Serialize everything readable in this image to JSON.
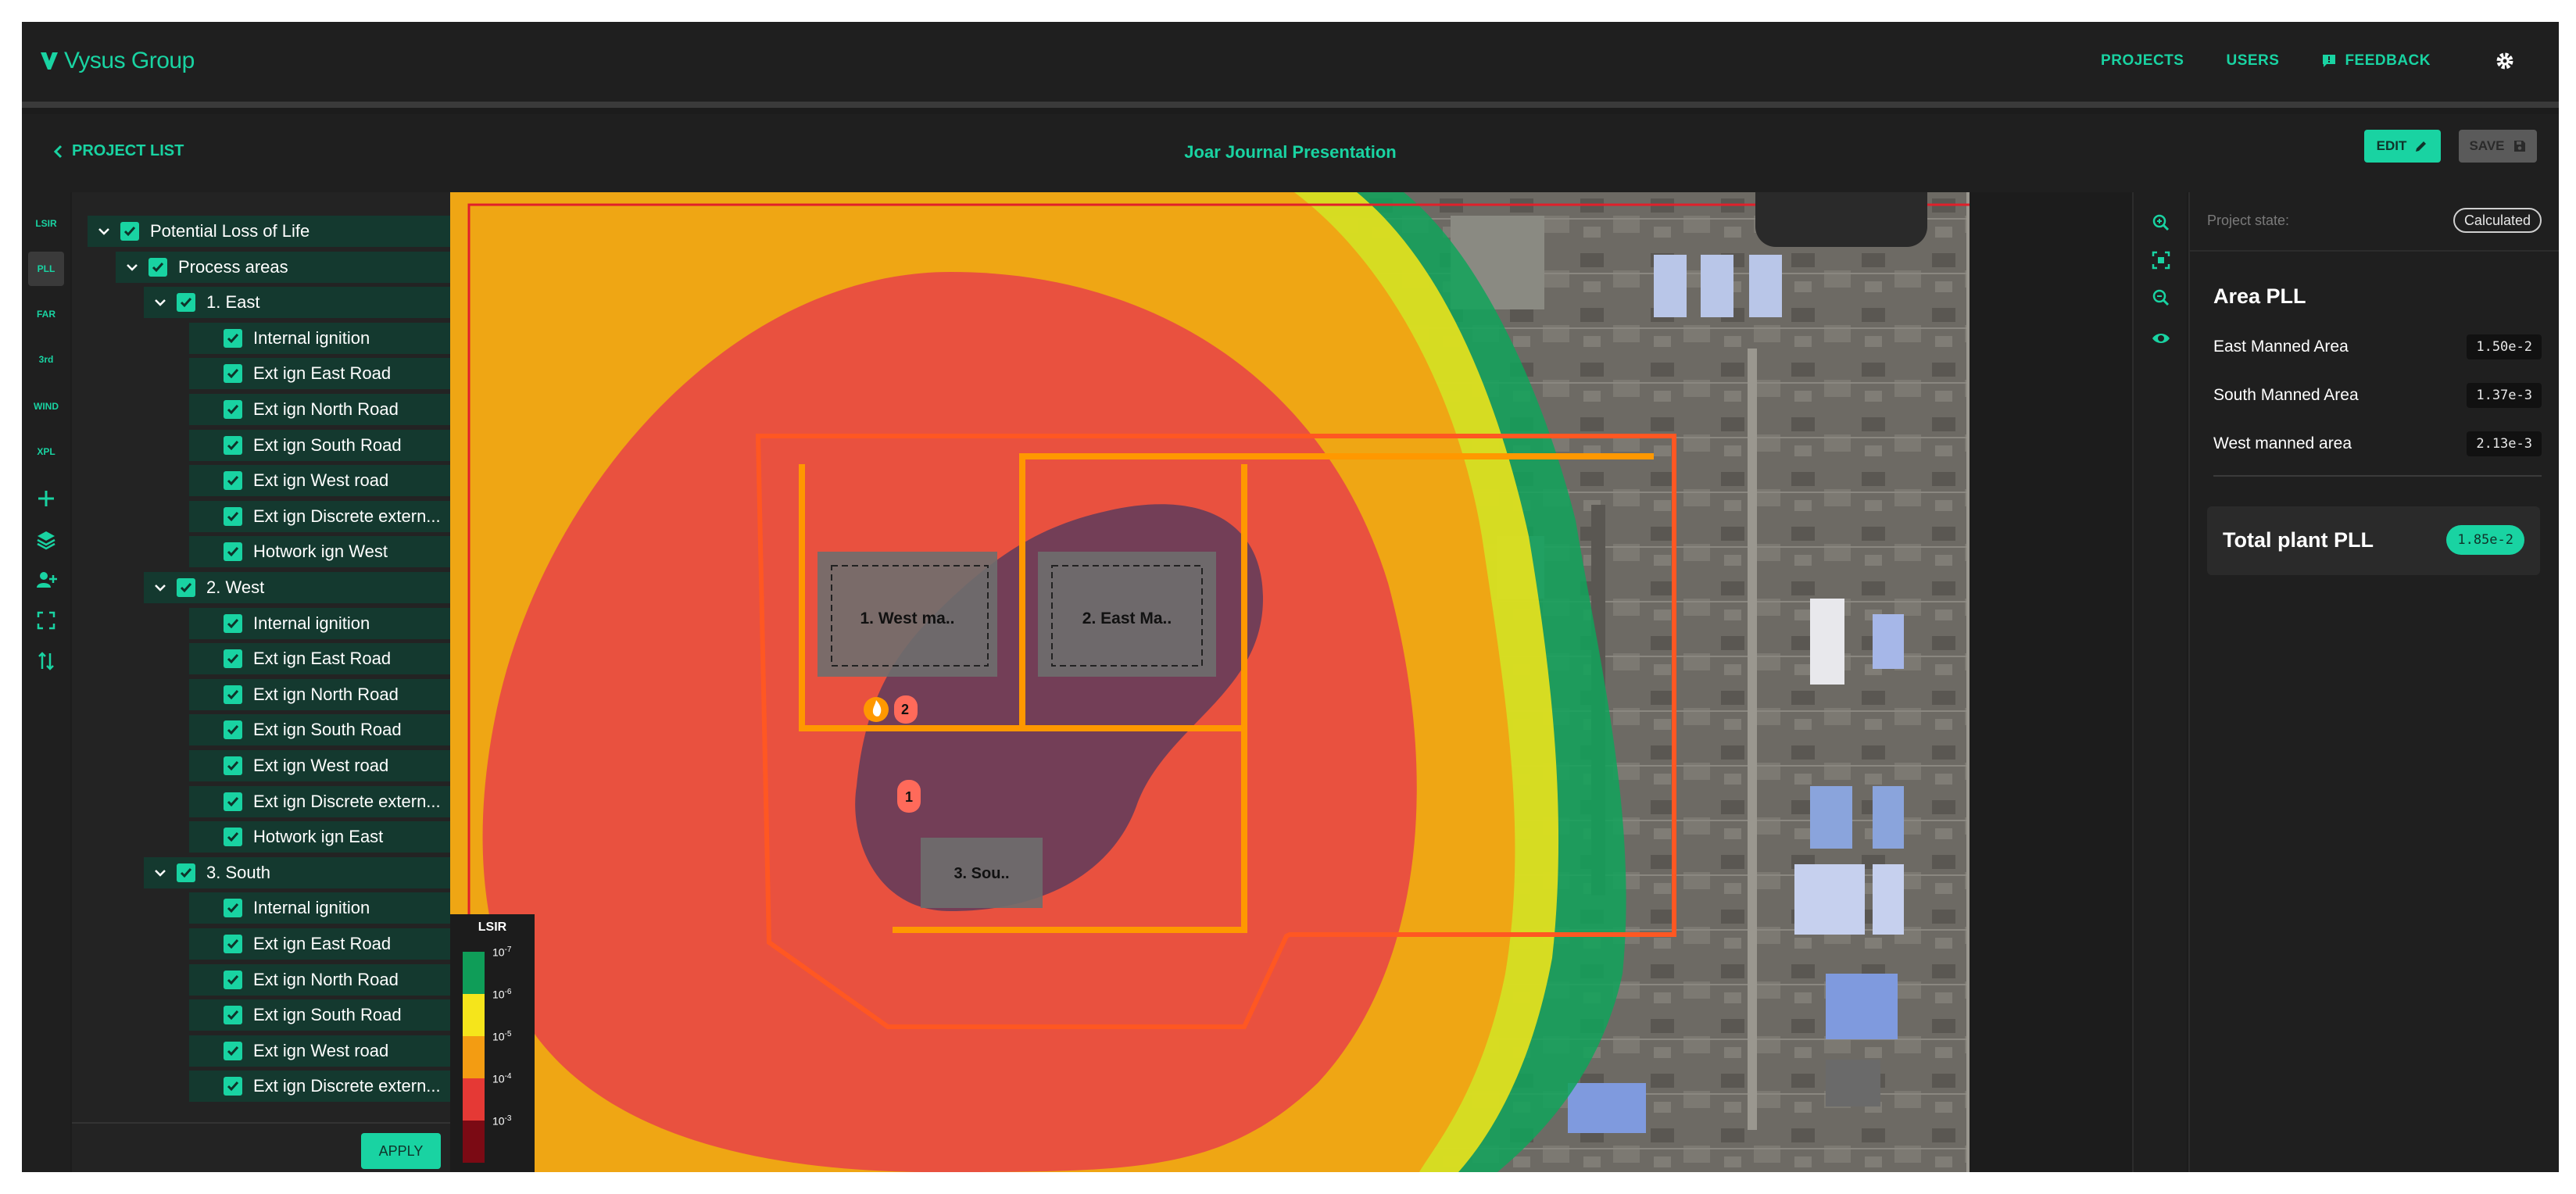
{
  "header": {
    "brand": "Vysus Group",
    "nav": {
      "projects": "PROJECTS",
      "users": "USERS",
      "feedback": "FEEDBACK"
    }
  },
  "project": {
    "back_label": "PROJECT LIST",
    "title": "Joar Journal Presentation",
    "edit_label": "EDIT",
    "save_label": "SAVE"
  },
  "rail": [
    "LSIR",
    "PLL",
    "FAR",
    "3rd",
    "WIND",
    "XPL"
  ],
  "tree": {
    "root": "Potential Loss of Life",
    "group": "Process areas",
    "areas": [
      {
        "name": "1. East",
        "items": [
          "Internal ignition",
          "Ext ign East Road",
          "Ext ign North Road",
          "Ext ign South Road",
          "Ext ign West road",
          "Ext ign Discrete extern...",
          "Hotwork ign West"
        ]
      },
      {
        "name": "2. West",
        "items": [
          "Internal ignition",
          "Ext ign East Road",
          "Ext ign North Road",
          "Ext ign South Road",
          "Ext ign West road",
          "Ext ign Discrete extern...",
          "Hotwork ign East"
        ]
      },
      {
        "name": "3. South",
        "items": [
          "Internal ignition",
          "Ext ign East Road",
          "Ext ign North Road",
          "Ext ign South Road",
          "Ext ign West road",
          "Ext ign Discrete extern..."
        ]
      }
    ],
    "apply_label": "APPLY"
  },
  "map": {
    "areas": [
      "1. West ma..",
      "2. East Ma..",
      "3. Sou.."
    ],
    "markers": [
      "2",
      "1"
    ]
  },
  "legend": {
    "title": "LSIR",
    "labels": [
      "10",
      "10",
      "10",
      "10",
      "10"
    ],
    "exponents": [
      "-7",
      "-6",
      "-5",
      "-4",
      "-3"
    ],
    "colors": [
      "#0f9d58",
      "#f5e51b",
      "#f39c12",
      "#e53935",
      "#7b0a14"
    ]
  },
  "panel": {
    "state_label": "Project state:",
    "state_value": "Calculated",
    "area_title": "Area PLL",
    "rows": [
      {
        "name": "East Manned Area",
        "value": "1.50e-2"
      },
      {
        "name": "South Manned Area",
        "value": "1.37e-3"
      },
      {
        "name": "West manned area",
        "value": "2.13e-3"
      }
    ],
    "total_label": "Total plant PLL",
    "total_value": "1.85e-2"
  },
  "colors": {
    "accent": "#19d3a2",
    "row_bg": "#14392f",
    "frame": "#e0202a"
  }
}
